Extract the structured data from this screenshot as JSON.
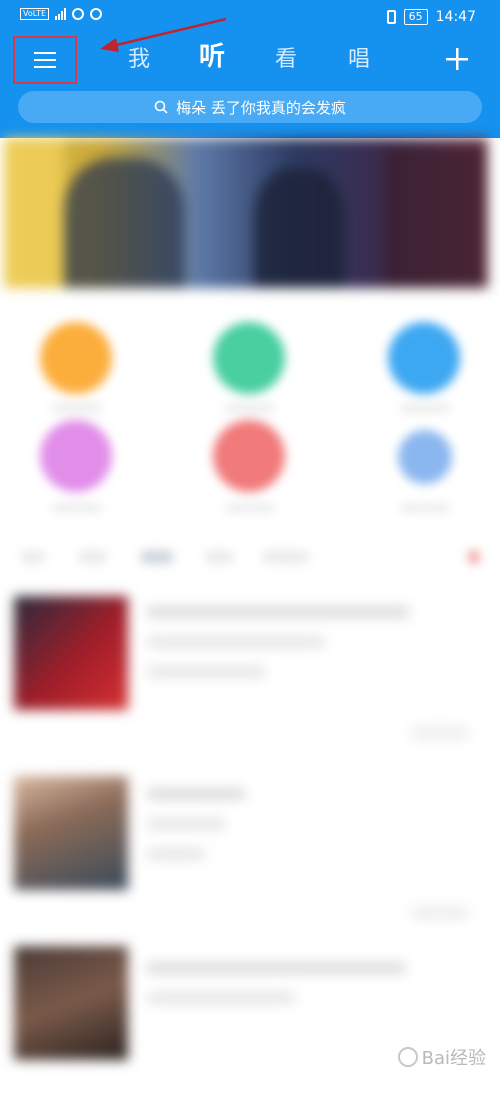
{
  "status": {
    "left_icons": [
      "volte-badge",
      "4g-signal-icon",
      "hotspot-icon",
      "alarm-icon"
    ],
    "time": "14:47",
    "battery": "65"
  },
  "nav": {
    "tabs": [
      {
        "label": "我",
        "active": false
      },
      {
        "label": "听",
        "active": true
      },
      {
        "label": "看",
        "active": false
      },
      {
        "label": "唱",
        "active": false
      }
    ],
    "add_label": "+"
  },
  "search": {
    "placeholder": "梅朵 丢了你我真的会发疯"
  },
  "colors": {
    "header_bg": "#1591f0",
    "search_bg": "#48aaf4",
    "highlight_border": "#d63b4a",
    "arrow": "#c0242e"
  },
  "watermark": {
    "text": "Bai经验"
  }
}
